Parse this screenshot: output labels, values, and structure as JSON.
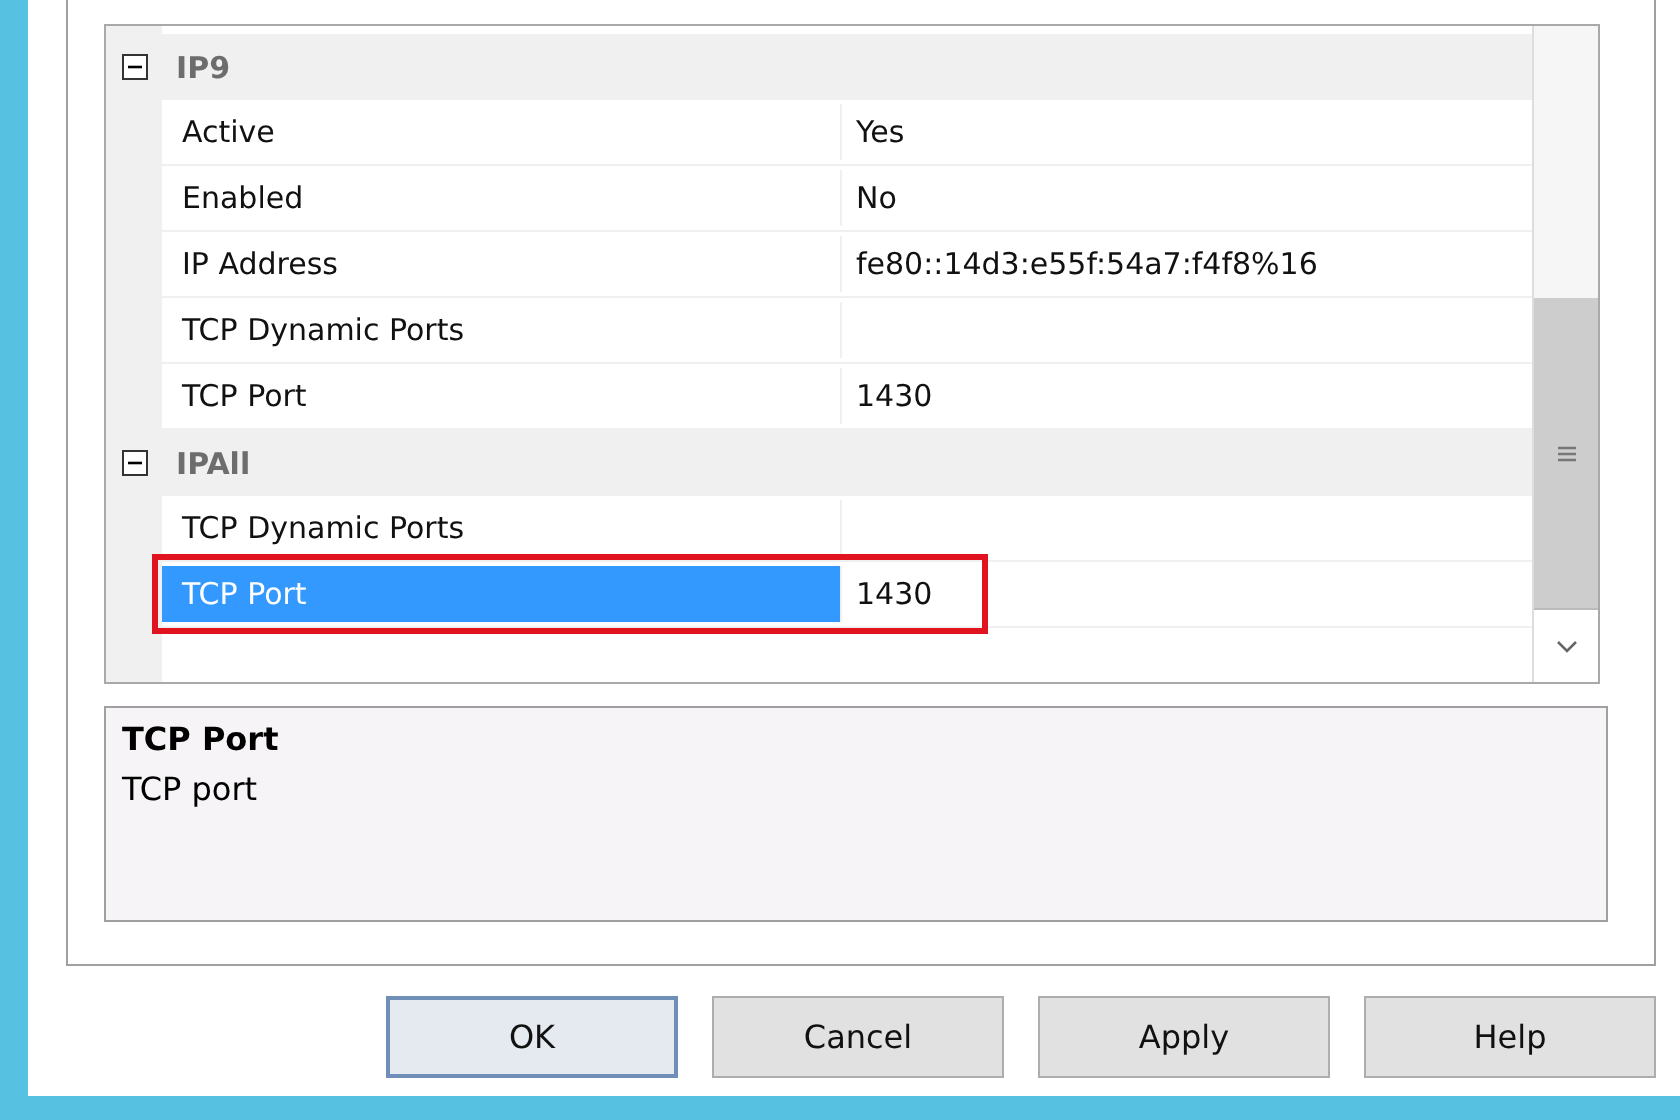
{
  "property_grid": {
    "categories": [
      {
        "name": "IP9",
        "expanded": true,
        "properties": [
          {
            "name": "Active",
            "value": "Yes",
            "selected": false,
            "outlined": false
          },
          {
            "name": "Enabled",
            "value": "No",
            "selected": false,
            "outlined": false
          },
          {
            "name": "IP Address",
            "value": "fe80::14d3:e55f:54a7:f4f8%16",
            "selected": false,
            "outlined": false
          },
          {
            "name": "TCP Dynamic Ports",
            "selected": false,
            "outlined": false
          },
          {
            "name": "TCP Port",
            "value": "1430",
            "selected": false,
            "outlined": false
          }
        ]
      },
      {
        "name": "IPAll",
        "expanded": true,
        "properties": [
          {
            "name": "TCP Dynamic Ports",
            "selected": false,
            "outlined": false
          },
          {
            "name": "TCP Port",
            "value": "1430",
            "selected": true,
            "outlined": true
          }
        ]
      }
    ]
  },
  "description": {
    "title": "TCP Port",
    "text": "TCP port"
  },
  "buttons": [
    {
      "label": "OK",
      "default": true
    },
    {
      "label": "Cancel",
      "default": false
    },
    {
      "label": "Apply",
      "default": false
    },
    {
      "label": "Help",
      "default": false
    }
  ]
}
